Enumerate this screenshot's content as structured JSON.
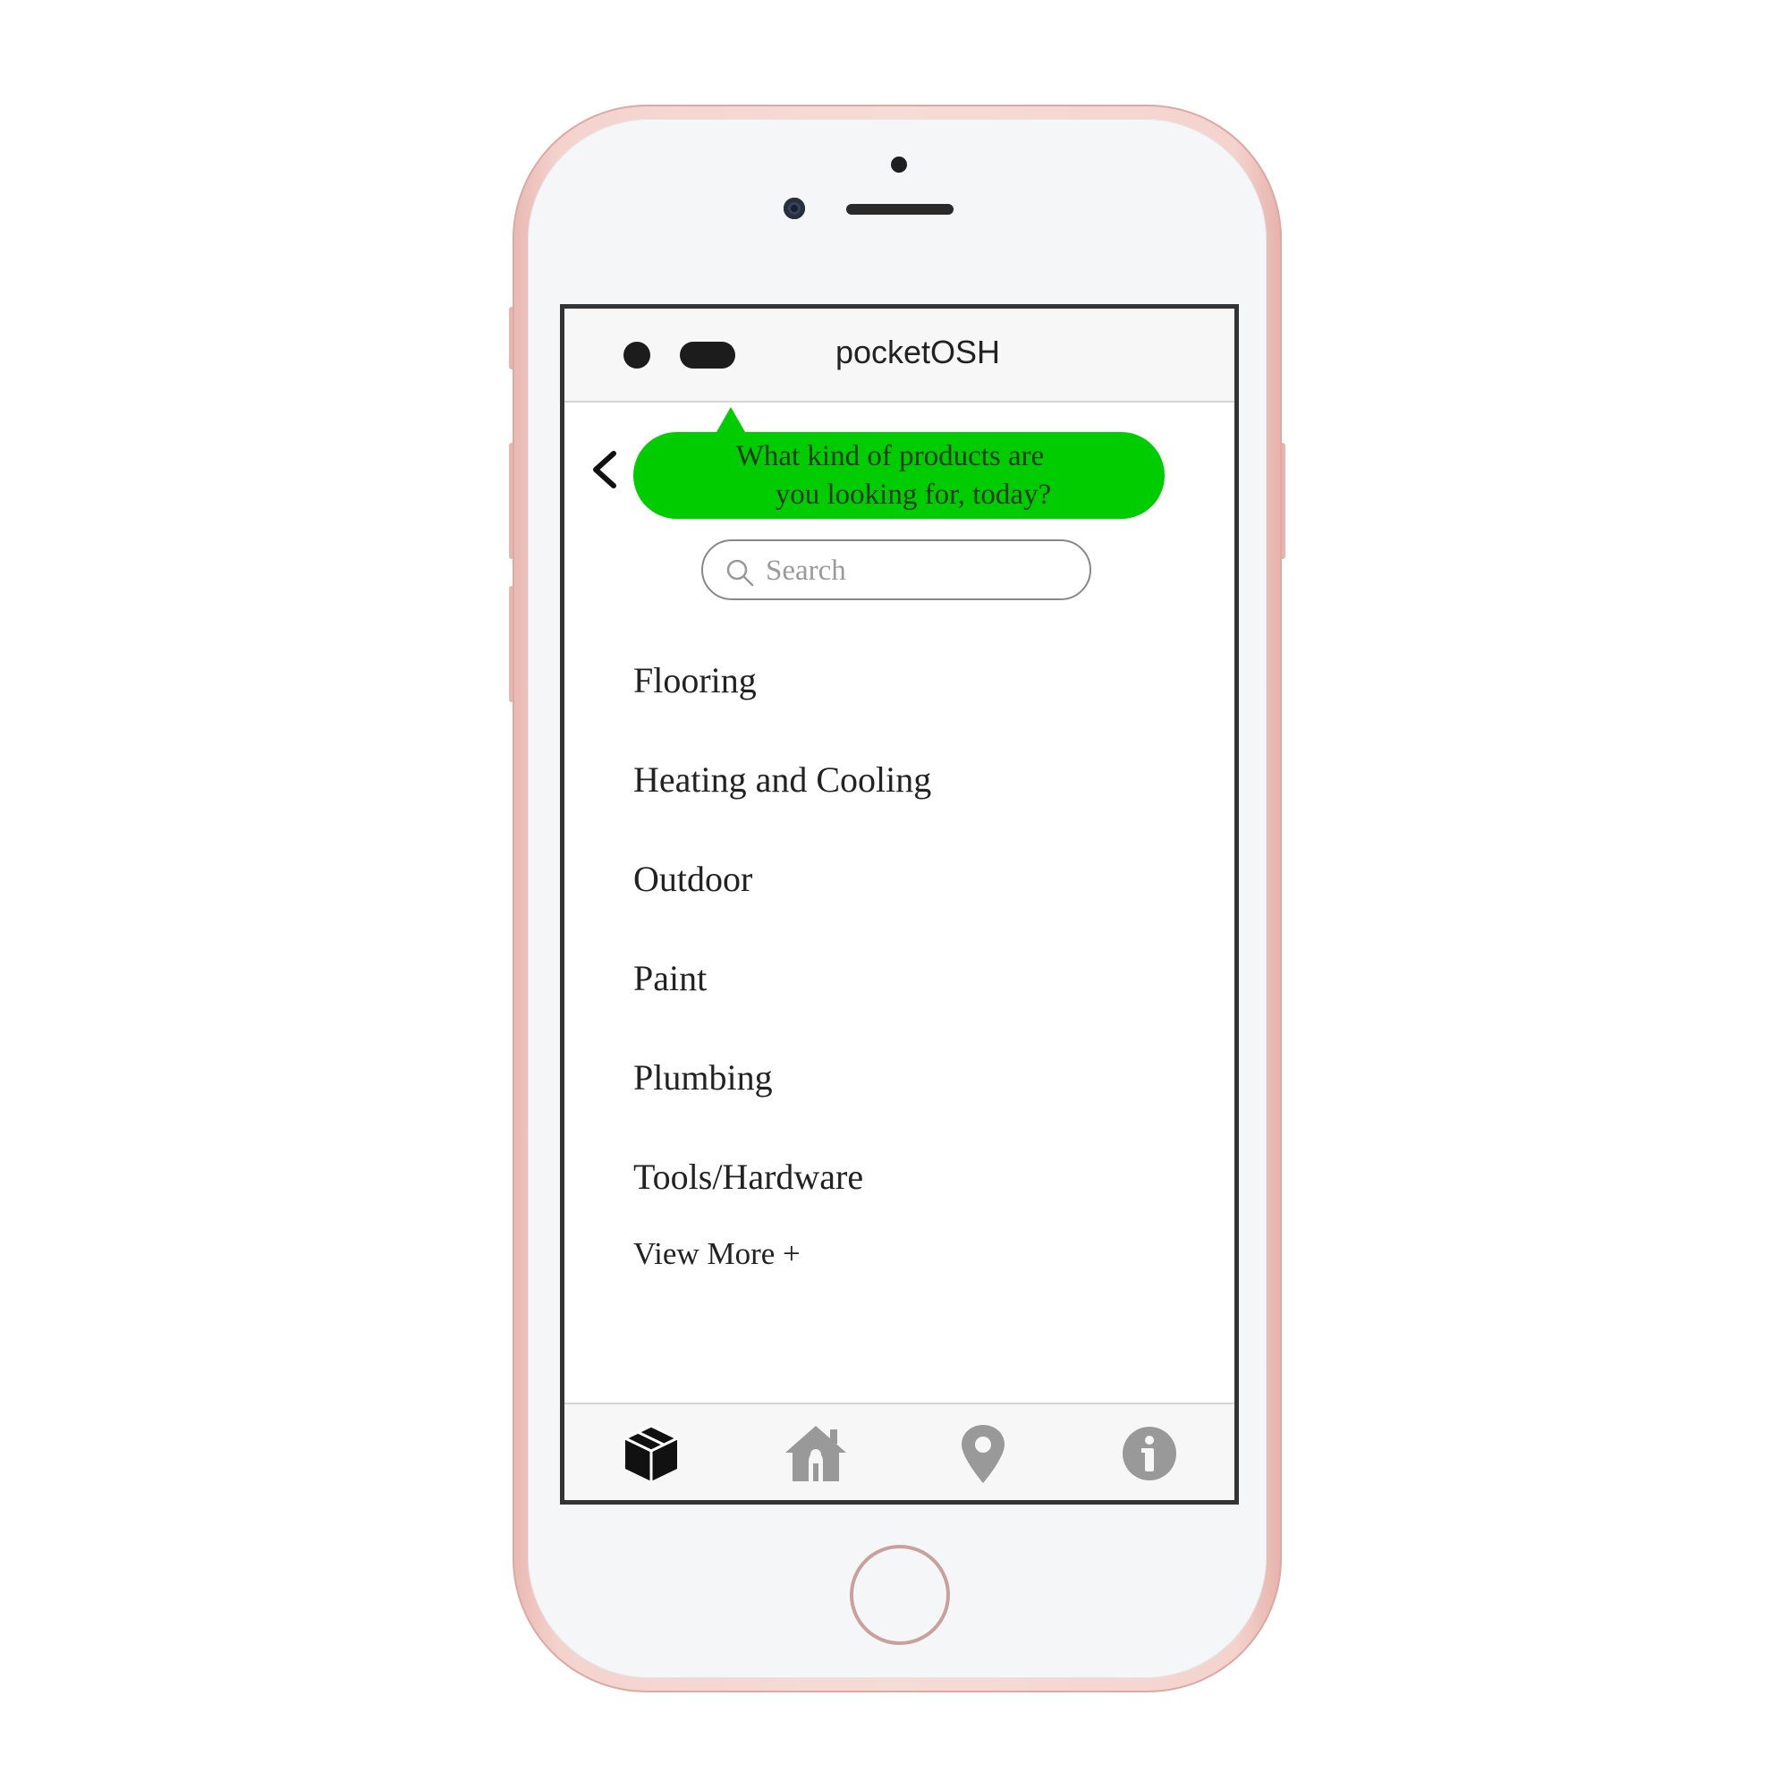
{
  "app": {
    "title": "pocketOSH"
  },
  "prompt": {
    "line1": "What kind of products are",
    "line2": "you looking for, today?"
  },
  "search": {
    "placeholder": "Search"
  },
  "categories": [
    "Flooring",
    "Heating and Cooling",
    "Outdoor",
    "Paint",
    "Plumbing",
    "Tools/Hardware"
  ],
  "view_more_label": "View More +",
  "tabs": [
    {
      "icon": "box-icon",
      "active": true
    },
    {
      "icon": "home-repair-icon",
      "active": false
    },
    {
      "icon": "location-pin-icon",
      "active": false
    },
    {
      "icon": "info-icon",
      "active": false
    }
  ],
  "colors": {
    "accent": "#00cc00",
    "active_tab": "#111111",
    "inactive_tab": "#999999",
    "phone_body": "#f4d3cd"
  }
}
